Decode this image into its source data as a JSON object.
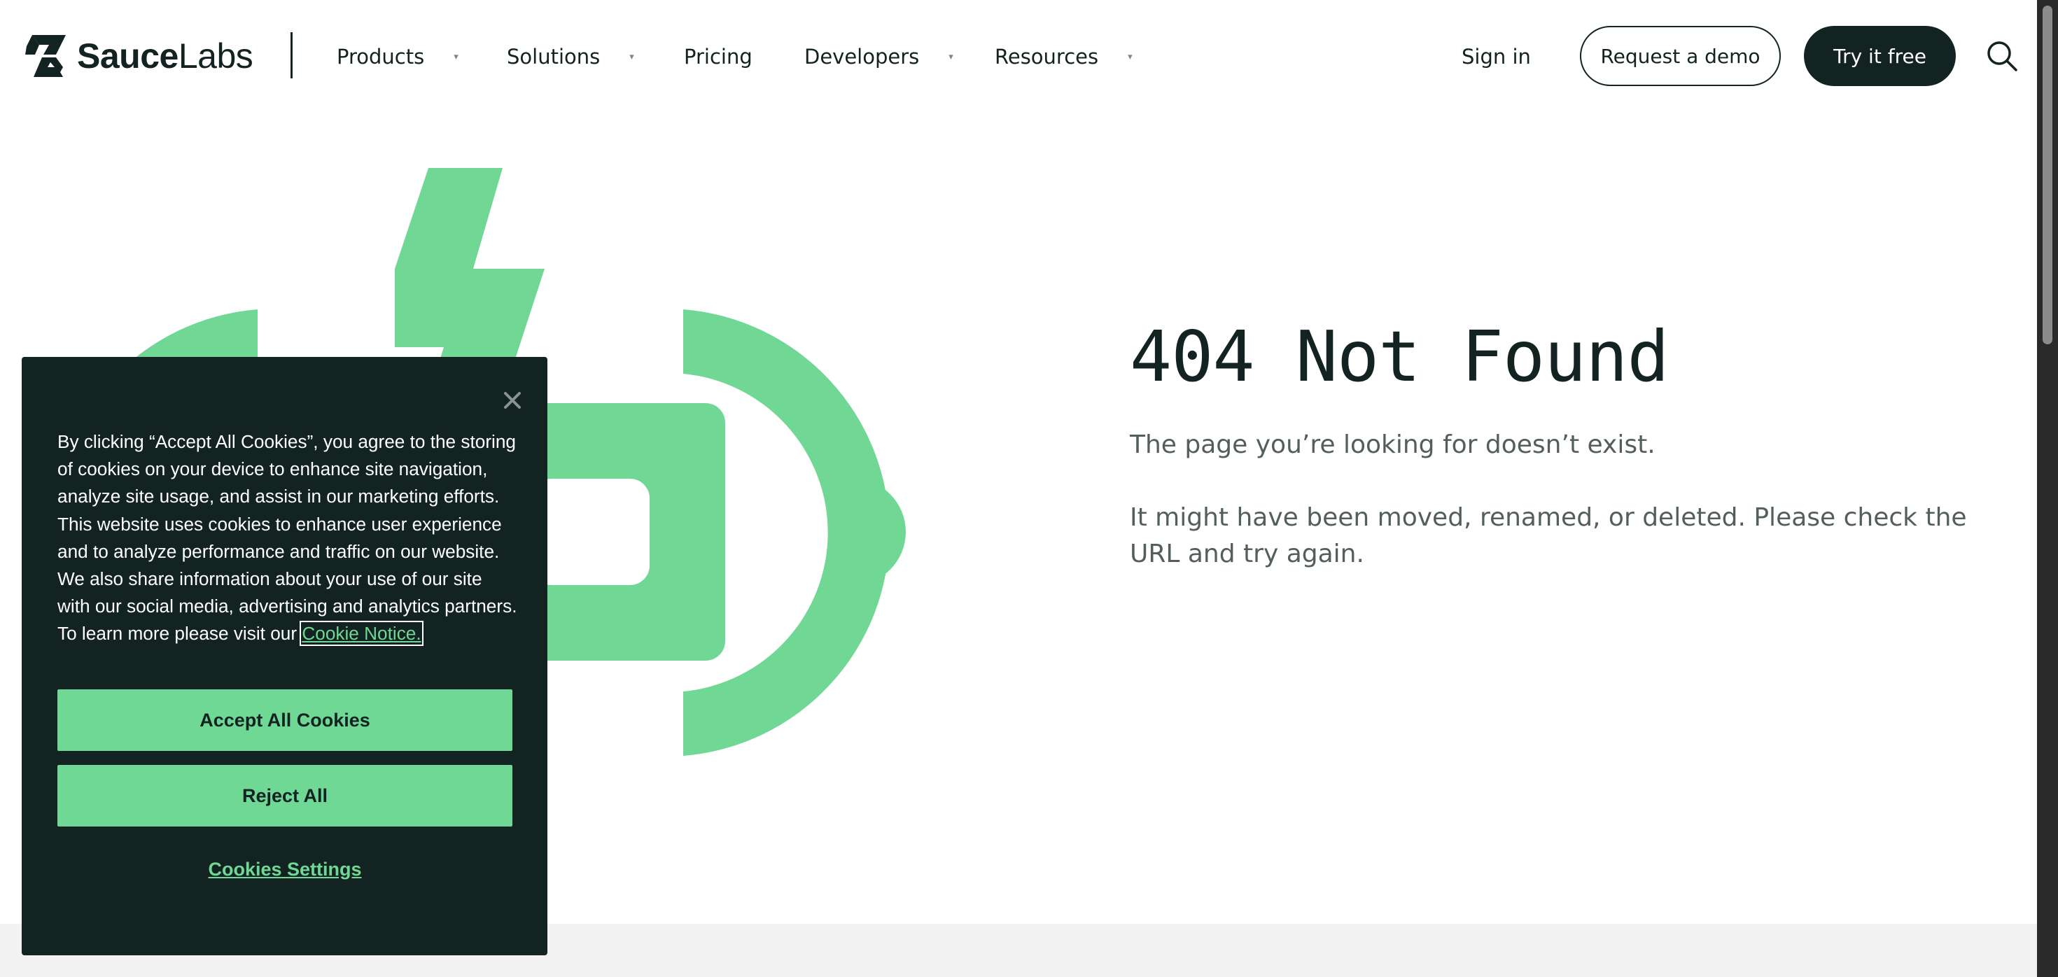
{
  "header": {
    "logo_bold": "Sauce",
    "logo_light": "Labs",
    "nav": [
      {
        "label": "Products",
        "has_dropdown": true
      },
      {
        "label": "Solutions",
        "has_dropdown": true
      },
      {
        "label": "Pricing",
        "has_dropdown": false
      },
      {
        "label": "Developers",
        "has_dropdown": true
      },
      {
        "label": "Resources",
        "has_dropdown": true
      }
    ],
    "caret_glyph": "▾",
    "sign_in": "Sign in",
    "request_demo": "Request a demo",
    "try_free": "Try it free",
    "search_icon": "search-icon"
  },
  "main": {
    "title": "404 Not Found",
    "paragraph_1": "The page you’re looking for doesn’t exist.",
    "paragraph_2": "It might have been moved, renamed, or deleted. Please check the URL and try again."
  },
  "cookie_banner": {
    "text": "By clicking “Accept All Cookies”, you agree to the storing of cookies on your device to enhance site navigation, analyze site usage, and assist in our marketing efforts. This website uses cookies to enhance user experience and to analyze performance and traffic on our website. We also share information about your use of our site with our social media, advertising and analytics partners. To learn more please visit our",
    "link_text": "Cookie Notice.",
    "accept": "Accept All Cookies",
    "reject": "Reject All",
    "settings": "Cookies Settings",
    "close_icon": "close-icon"
  },
  "colors": {
    "brand_dark": "#132322",
    "brand_green": "#6fd894",
    "illustration_green": "#70d894",
    "body_text": "#535e5d",
    "footer_strip": "#f2f2f2"
  }
}
